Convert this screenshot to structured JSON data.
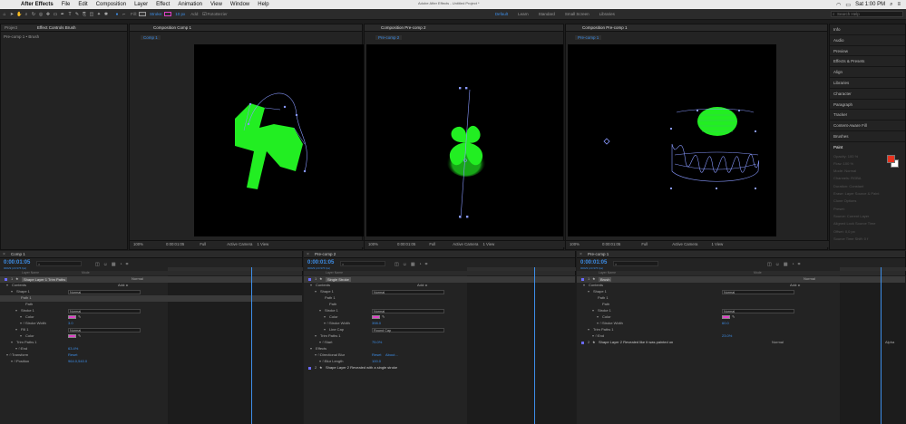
{
  "menubar": {
    "apple": "",
    "app": "After Effects",
    "items": [
      "File",
      "Edit",
      "Composition",
      "Layer",
      "Effect",
      "Animation",
      "View",
      "Window",
      "Help"
    ],
    "time": "Sat 1:00 PM"
  },
  "toolbar": {
    "fill_label": "Fill:",
    "stroke_label": "Stroke:",
    "stroke_width": "10 px",
    "add_label": "Add:",
    "rotobezier": "RotoBezier",
    "window_title": "Adobe After Effects - Untitled Project *",
    "workspaces": [
      "Default",
      "Learn",
      "Standard",
      "Small Screen",
      "Libraries"
    ],
    "search_placeholder": "Search Help"
  },
  "left_panel": {
    "tabs": [
      "Project",
      "Effect Controls Brush"
    ],
    "subtitle": "Pre-comp 1 • Brush"
  },
  "viewers": [
    {
      "tab": "Composition Comp 1",
      "label": "Comp 1",
      "zoom": "100%",
      "timecode": "0:00:01:05",
      "res": "Full",
      "camera": "Active Camera",
      "view": "1 View"
    },
    {
      "tab": "Composition Pre-comp 2",
      "label": "Pre-comp 2",
      "zoom": "100%",
      "timecode": "0:00:01:05",
      "res": "Full",
      "camera": "Active Camera",
      "view": "1 View"
    },
    {
      "tab": "Composition Pre-comp 1",
      "label": "Pre-comp 1",
      "zoom": "100%",
      "timecode": "0:00:01:05",
      "res": "Full",
      "camera": "Active Camera",
      "view": "1 View"
    }
  ],
  "right_panel": {
    "items": [
      "Info",
      "Audio",
      "Preview",
      "Effects & Presets",
      "Align",
      "Libraries",
      "Character",
      "Paragraph",
      "Tracker",
      "Content-Aware Fill",
      "Brushes"
    ],
    "paint_title": "Paint",
    "paint_rows": [
      "Opacity: 100 %",
      "Flow: 100 %",
      "Mode: Normal",
      "Channels: RGBA",
      "Duration: Constant",
      "Erase: Layer Source & Paint",
      "Clone Options",
      "Preset:",
      "Source: Current Layer",
      "Aligned   Lock Source Time",
      "Offset: 0,0 px",
      "Source Time Shift: 0 f"
    ],
    "fg_color": "#e8321e",
    "bg_color": "#ffffff"
  },
  "timelines": [
    {
      "title": "Comp 1",
      "timecode": "0:00:01:05",
      "fps": "00029 (23.976 fps)",
      "col_layer": "Layer Name",
      "col_mode": "Mode",
      "layer": {
        "num": "1",
        "name": "Shape Layer 1 Trim Paths",
        "mode": "Normal"
      },
      "rows": [
        {
          "indent": 1,
          "label": "Contents",
          "value": "",
          "kind": "add"
        },
        {
          "indent": 2,
          "label": "Shape 1",
          "value": "Normal",
          "kind": "dd"
        },
        {
          "indent": 3,
          "label": "Path 1",
          "value": "",
          "kind": "none",
          "sel": true
        },
        {
          "indent": 4,
          "label": "Path",
          "value": "",
          "kind": "none"
        },
        {
          "indent": 3,
          "label": "Stroke 1",
          "value": "Normal",
          "kind": "dd"
        },
        {
          "indent": 4,
          "label": "Color",
          "value": "",
          "kind": "swatch"
        },
        {
          "indent": 4,
          "label": "Stroke Width",
          "value": "3.0",
          "kind": "val"
        },
        {
          "indent": 3,
          "label": "Fill 1",
          "value": "Normal",
          "kind": "dd"
        },
        {
          "indent": 4,
          "label": "Color",
          "value": "",
          "kind": "swatch"
        },
        {
          "indent": 2,
          "label": "Trim Paths 1",
          "value": "",
          "kind": "none"
        },
        {
          "indent": 3,
          "label": "End",
          "value": "63.4%",
          "kind": "val"
        },
        {
          "indent": 1,
          "label": "Transform",
          "value": "Reset",
          "kind": "val"
        },
        {
          "indent": 2,
          "label": "Position",
          "value": "964.0,540.0",
          "kind": "val"
        }
      ],
      "layer2": null
    },
    {
      "title": "Pre-comp 2",
      "timecode": "0:00:01:05",
      "fps": "00029 (23.976 fps)",
      "col_layer": "Layer Name",
      "col_mode": "",
      "layer": {
        "num": "1",
        "name": "Single Stroke",
        "mode": ""
      },
      "rows": [
        {
          "indent": 1,
          "label": "Contents",
          "value": "",
          "kind": "add"
        },
        {
          "indent": 2,
          "label": "Shape 1",
          "value": "Normal",
          "kind": "dd"
        },
        {
          "indent": 3,
          "label": "Path 1",
          "value": "",
          "kind": "none"
        },
        {
          "indent": 4,
          "label": "Path",
          "value": "",
          "kind": "none"
        },
        {
          "indent": 3,
          "label": "Stroke 1",
          "value": "Normal",
          "kind": "dd"
        },
        {
          "indent": 4,
          "label": "Color",
          "value": "",
          "kind": "swatch"
        },
        {
          "indent": 4,
          "label": "Stroke Width",
          "value": "398.0",
          "kind": "val"
        },
        {
          "indent": 4,
          "label": "Line Cap",
          "value": "Round Cap",
          "kind": "dd"
        },
        {
          "indent": 2,
          "label": "Trim Paths 1",
          "value": "",
          "kind": "none"
        },
        {
          "indent": 3,
          "label": "Start",
          "value": "75.0%",
          "kind": "val"
        },
        {
          "indent": 1,
          "label": "Effects",
          "value": "",
          "kind": "none"
        },
        {
          "indent": 2,
          "label": "Directional Blur",
          "value": "Reset",
          "kind": "val",
          "extra": "About..."
        },
        {
          "indent": 3,
          "label": "Blur Length",
          "value": "100.0",
          "kind": "val"
        }
      ],
      "layer2": {
        "num": "2",
        "name": "Shape Layer 2 Revealed with a single stroke",
        "mode": ""
      }
    },
    {
      "title": "Pre-comp 1",
      "timecode": "0:00:01:05",
      "fps": "00029 (23.976 fps)",
      "col_layer": "Layer Name",
      "col_mode": "Mode",
      "layer": {
        "num": "1",
        "name": "Brush",
        "mode": "Normal"
      },
      "rows": [
        {
          "indent": 1,
          "label": "Contents",
          "value": "",
          "kind": "add"
        },
        {
          "indent": 2,
          "label": "Shape 1",
          "value": "Normal",
          "kind": "dd"
        },
        {
          "indent": 3,
          "label": "Path 1",
          "value": "",
          "kind": "none"
        },
        {
          "indent": 4,
          "label": "Path",
          "value": "",
          "kind": "none"
        },
        {
          "indent": 3,
          "label": "Stroke 1",
          "value": "Normal",
          "kind": "dd"
        },
        {
          "indent": 4,
          "label": "Color",
          "value": "",
          "kind": "swatch"
        },
        {
          "indent": 4,
          "label": "Stroke Width",
          "value": "60.0",
          "kind": "val"
        },
        {
          "indent": 2,
          "label": "Trim Paths 1",
          "value": "",
          "kind": "none"
        },
        {
          "indent": 3,
          "label": "End",
          "value": "23.0%",
          "kind": "val"
        }
      ],
      "layer2": {
        "num": "2",
        "name": "Shape Layer 2 Revealed like it was painted on",
        "mode": "Normal",
        "extra": "Alpha"
      }
    }
  ],
  "colors": {
    "accent": "#3d8ee8",
    "shape_green": "#22ee22",
    "stroke_magenta": "#e040c8"
  }
}
